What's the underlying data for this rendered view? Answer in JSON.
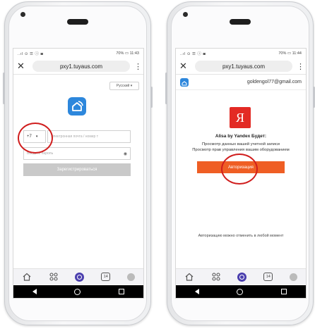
{
  "left": {
    "status": {
      "icons": "..ıl ⊙ ☰ ⓘ ◙",
      "battery_time": "70% ▭ 11:43"
    },
    "browser": {
      "close": "✕",
      "url": "pxy1.tuyaus.com",
      "menu": "⋮"
    },
    "language": "Русский ▾",
    "country_code": "+7",
    "country_arrow": "▾",
    "phone_placeholder": "Электронная почта / номер т",
    "password_placeholder": "Введите пароль",
    "register_label": "Зарегистрироваться"
  },
  "right": {
    "status": {
      "icons": "..ıl ⊙ ☰ ⓘ ◙",
      "battery_time": "70% ▭ 11:44"
    },
    "browser": {
      "close": "✕",
      "url": "pxy1.tuyaus.com",
      "menu": "⋮"
    },
    "account_email": "goldengol77@gmail.com",
    "yandex_letter": "Я",
    "title": "Alisa by Yandex Будет:",
    "permission_1": "Просмотр данных вашей учетной записи",
    "permission_2": "Просмотр прав управления вашим оборудованием",
    "authorize_label": "Авторизация",
    "revoke_note": "Авторизацию можно отменить в любой момент"
  },
  "nav": {
    "home_icon": "home-icon",
    "scenes_icon": "grid-icon",
    "calendar_day": "14",
    "profile_icon": "avatar-icon"
  },
  "colors": {
    "accent_blue": "#2d87dc",
    "yandex_red": "#e32a24",
    "authorize_orange": "#ef5e24",
    "nav_purple": "#4b3fae",
    "annotation_red": "#d01d1d"
  }
}
